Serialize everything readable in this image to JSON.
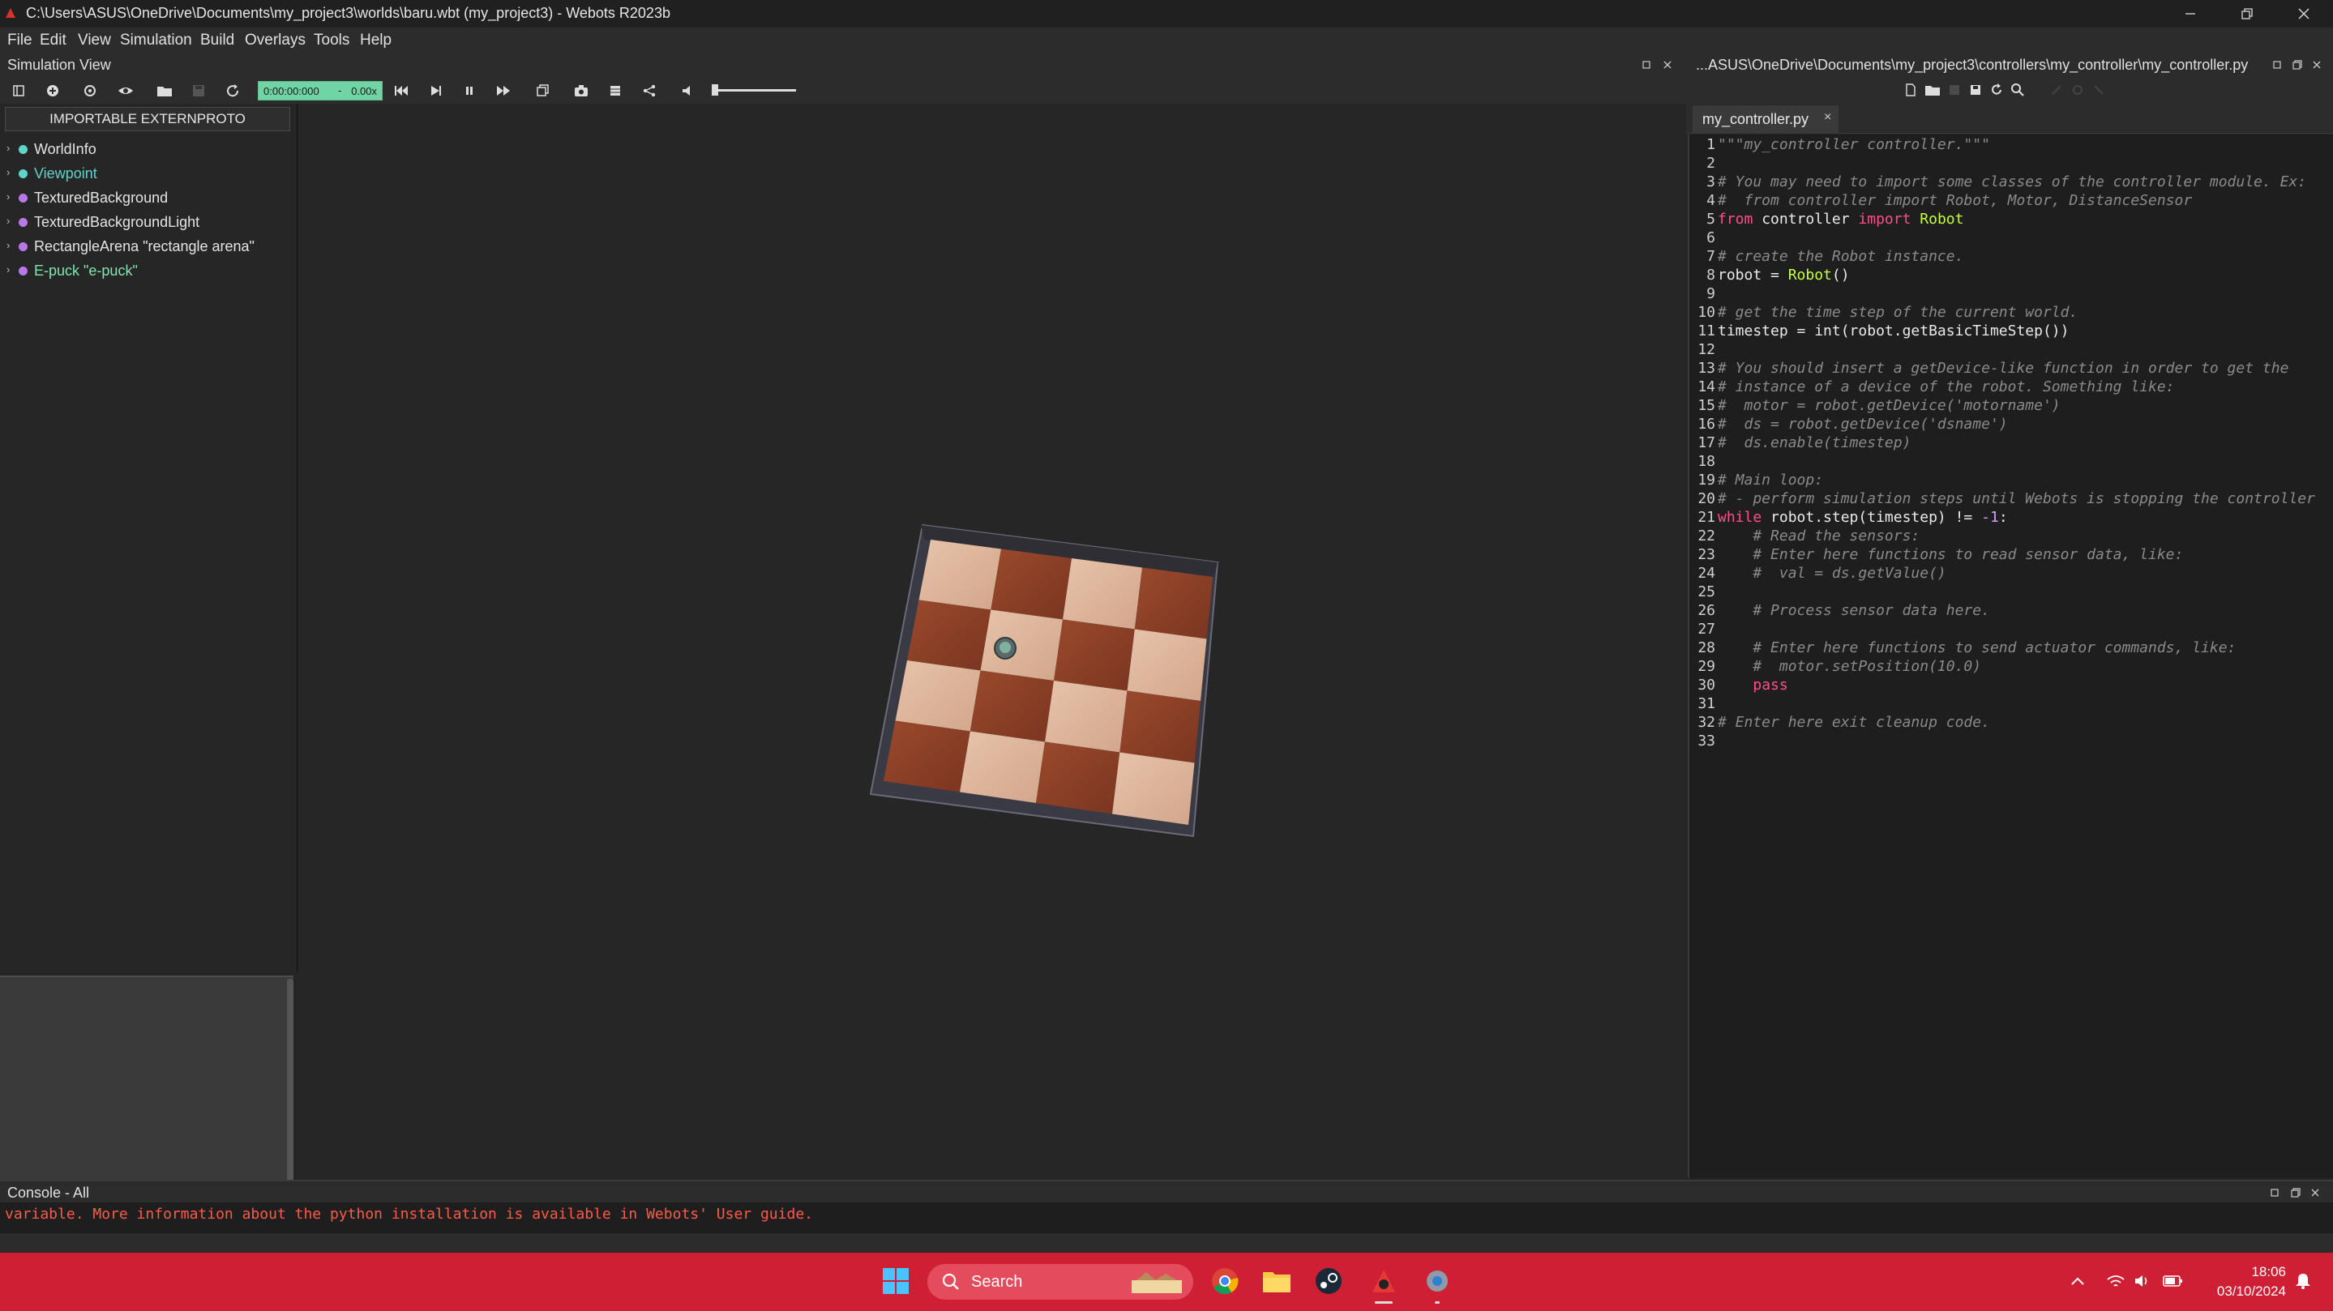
{
  "window": {
    "title": "C:\\Users\\ASUS\\OneDrive\\Documents\\my_project3\\worlds\\baru.wbt (my_project3) - Webots R2023b"
  },
  "menu": [
    "File",
    "Edit",
    "View",
    "Simulation",
    "Build",
    "Overlays",
    "Tools",
    "Help"
  ],
  "simulation_view": {
    "label": "Simulation View",
    "time": "0:00:00:000",
    "separator": "-",
    "speed": "0.00x"
  },
  "scene_tree": {
    "externproto_button": "IMPORTABLE EXTERNPROTO",
    "items": [
      {
        "label": "WorldInfo",
        "dot": "#62d3c8",
        "text_color": "#e4e4e4"
      },
      {
        "label": "Viewpoint",
        "dot": "#62d3c8",
        "text_color": "#62d3c8"
      },
      {
        "label": "TexturedBackground",
        "dot": "#b778e8",
        "text_color": "#e4e4e4"
      },
      {
        "label": "TexturedBackgroundLight",
        "dot": "#b778e8",
        "text_color": "#e4e4e4"
      },
      {
        "label": "RectangleArena \"rectangle arena\"",
        "dot": "#b778e8",
        "text_color": "#e4e4e4"
      },
      {
        "label": "E-puck \"e-puck\"",
        "dot": "#b778e8",
        "text_color": "#7ee7b0"
      }
    ]
  },
  "editor": {
    "path": "...ASUS\\OneDrive\\Documents\\my_project3\\controllers\\my_controller\\my_controller.py",
    "tab": "my_controller.py",
    "lines": [
      [
        [
          "c",
          "\"\"\"my_controller controller.\"\"\""
        ]
      ],
      [],
      [
        [
          "c",
          "# You may need to import some classes of the controller module. Ex:"
        ]
      ],
      [
        [
          "c",
          "#  from controller import Robot, Motor, DistanceSensor"
        ]
      ],
      [
        [
          "k",
          "from"
        ],
        [
          "w",
          " controller "
        ],
        [
          "k",
          "import"
        ],
        [
          "f",
          " Robot"
        ]
      ],
      [],
      [
        [
          "c",
          "# create the Robot instance."
        ]
      ],
      [
        [
          "w",
          "robot = "
        ],
        [
          "f",
          "Robot"
        ],
        [
          "w",
          "()"
        ]
      ],
      [],
      [
        [
          "c",
          "# get the time step of the current world."
        ]
      ],
      [
        [
          "w",
          "timestep = int(robot.getBasicTimeStep())"
        ]
      ],
      [],
      [
        [
          "c",
          "# You should insert a getDevice-like function in order to get the"
        ]
      ],
      [
        [
          "c",
          "# instance of a device of the robot. Something like:"
        ]
      ],
      [
        [
          "c",
          "#  motor = robot.getDevice('motorname')"
        ]
      ],
      [
        [
          "c",
          "#  ds = robot.getDevice('dsname')"
        ]
      ],
      [
        [
          "c",
          "#  ds.enable(timestep)"
        ]
      ],
      [],
      [
        [
          "c",
          "# Main loop:"
        ]
      ],
      [
        [
          "c",
          "# - perform simulation steps until Webots is stopping the controller"
        ]
      ],
      [
        [
          "k",
          "while"
        ],
        [
          "w",
          " robot.step(timestep) != "
        ],
        [
          "n",
          "-1"
        ],
        [
          "w",
          ":"
        ]
      ],
      [
        [
          "c",
          "    # Read the sensors:"
        ]
      ],
      [
        [
          "c",
          "    # Enter here functions to read sensor data, like:"
        ]
      ],
      [
        [
          "c",
          "    #  val = ds.getValue()"
        ]
      ],
      [],
      [
        [
          "c",
          "    # Process sensor data here."
        ]
      ],
      [],
      [
        [
          "c",
          "    # Enter here functions to send actuator commands, like:"
        ]
      ],
      [
        [
          "c",
          "    #  motor.setPosition(10.0)"
        ]
      ],
      [
        [
          "w",
          "    "
        ],
        [
          "k",
          "pass"
        ]
      ],
      [],
      [
        [
          "c",
          "# Enter here exit cleanup code."
        ]
      ],
      []
    ]
  },
  "console": {
    "label": "Console - All",
    "message": "variable. More information about the python installation is available in Webots' User guide."
  },
  "taskbar": {
    "search_label": "Search",
    "time": "18:06",
    "date": "03/10/2024"
  },
  "colors": {
    "taskbar": "#cf1f35",
    "time_box": "#70d4a4",
    "accent_green": "#7ee7b0"
  }
}
